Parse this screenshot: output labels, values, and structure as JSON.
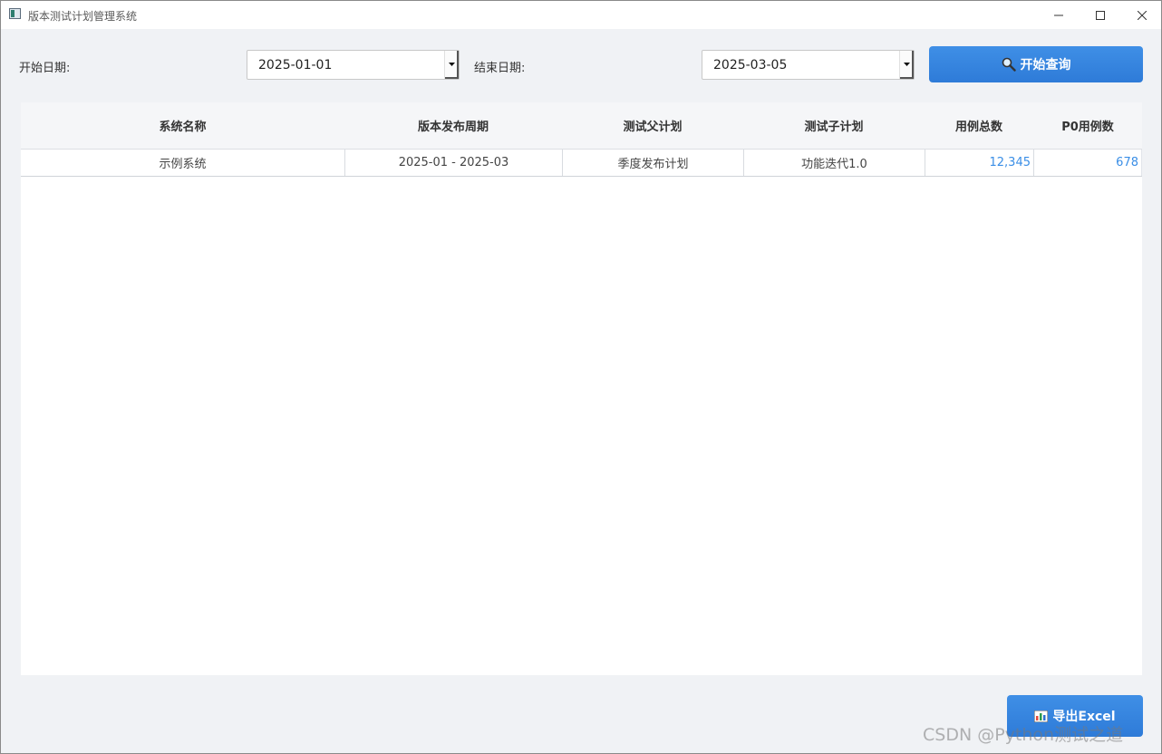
{
  "window": {
    "title": "版本测试计划管理系统"
  },
  "filters": {
    "start_label": "开始日期:",
    "start_value": "2025-01-01",
    "end_label": "结束日期:",
    "end_value": "2025-03-05",
    "query_button": "开始查询"
  },
  "table": {
    "columns": [
      "系统名称",
      "版本发布周期",
      "测试父计划",
      "测试子计划",
      "用例总数",
      "P0用例数"
    ],
    "rows": [
      [
        "示例系统",
        "2025-01 - 2025-03",
        "季度发布计划",
        "功能迭代1.0",
        "12,345",
        "678"
      ]
    ]
  },
  "footer": {
    "export_button": "导出Excel"
  },
  "watermark": "CSDN @Python测试之道",
  "colors": {
    "accent": "#2e7bd8",
    "numeric_text": "#3a8ee6",
    "background": "#f0f2f5"
  },
  "icons": {
    "query": "search-icon",
    "export": "bar-chart-icon"
  }
}
